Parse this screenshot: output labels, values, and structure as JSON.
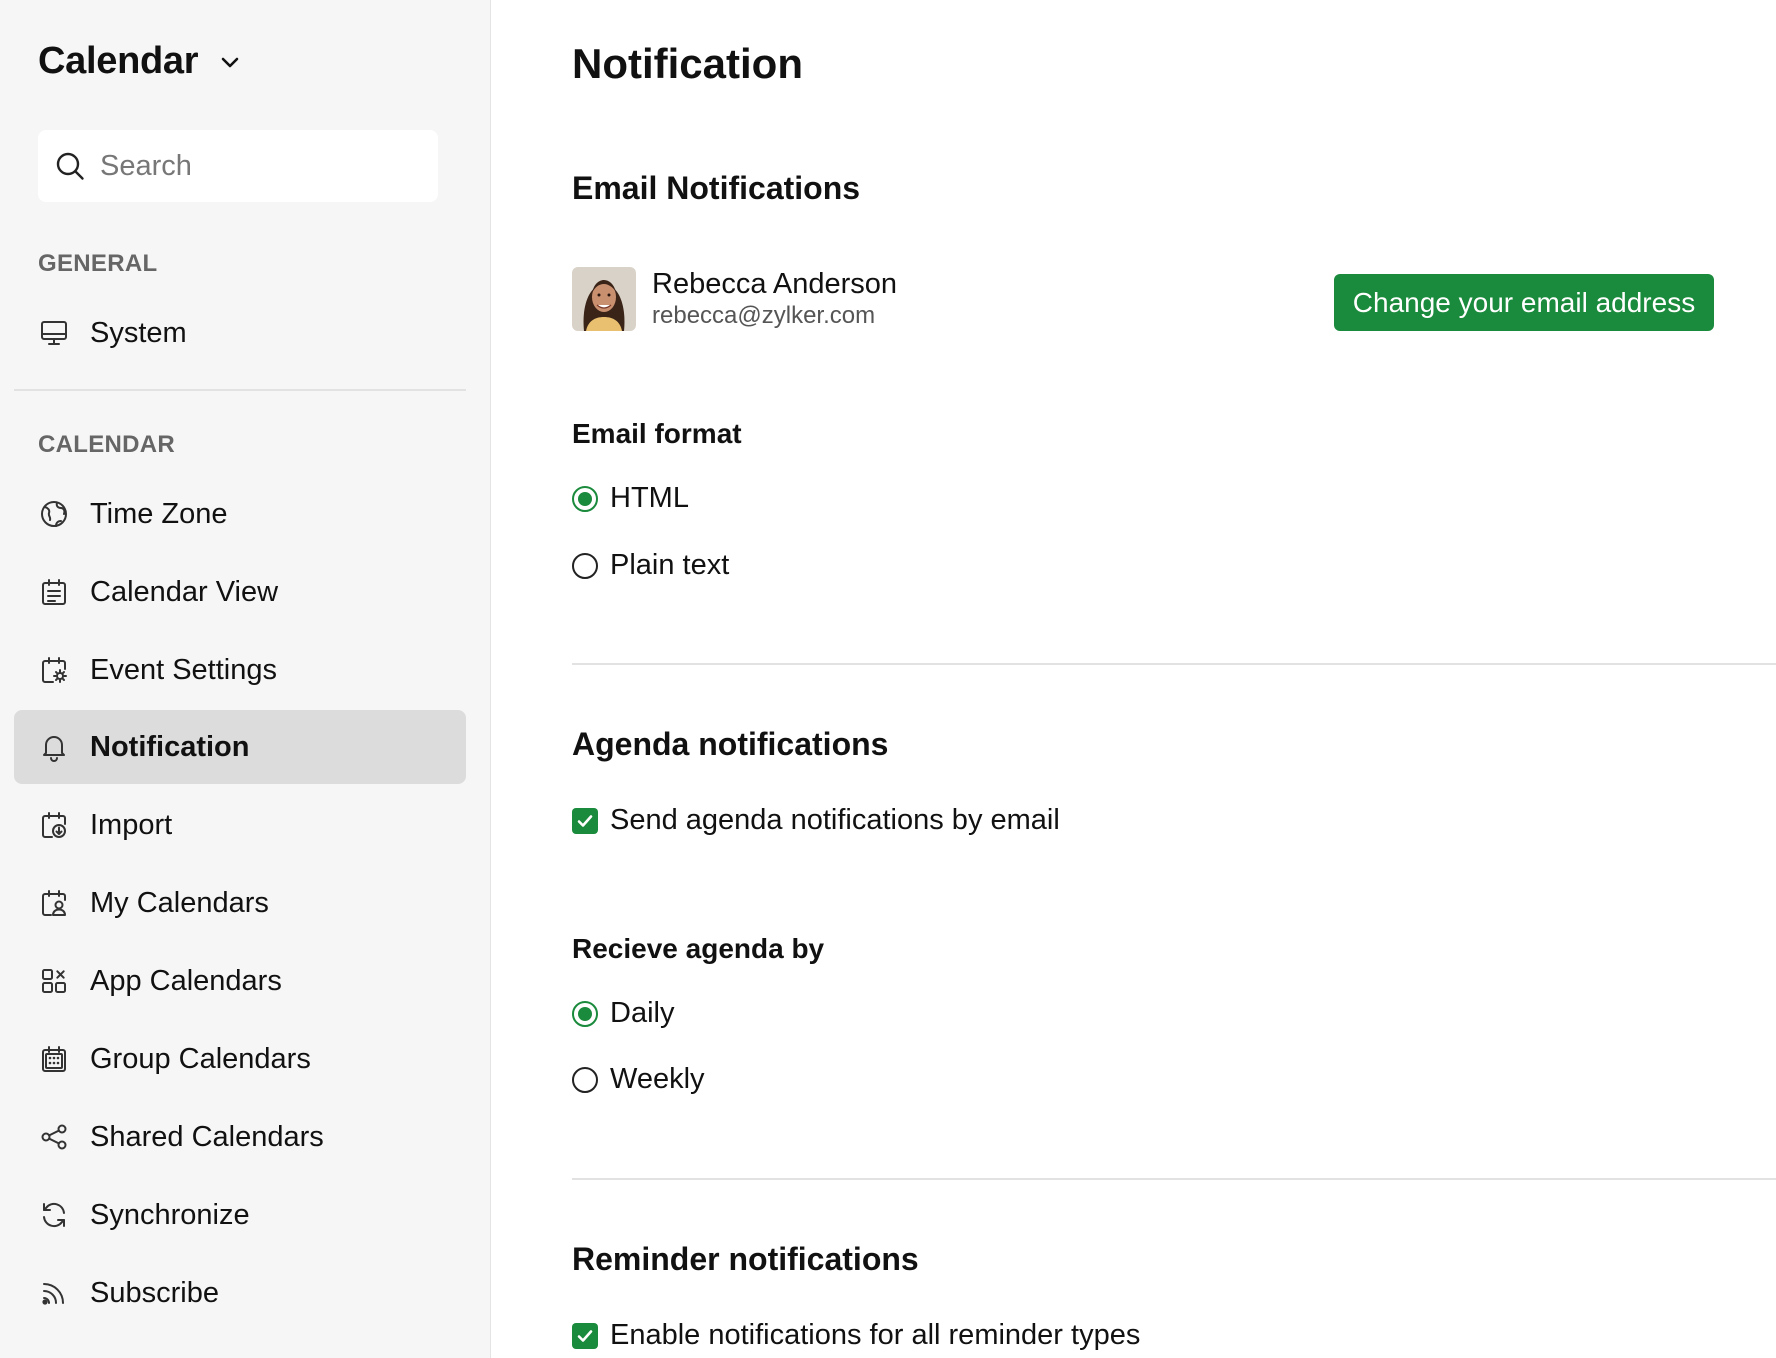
{
  "sidebar": {
    "app_title": "Calendar",
    "search": {
      "placeholder": "Search",
      "value": ""
    },
    "sections": {
      "general": {
        "title": "GENERAL",
        "items": [
          {
            "label": "System",
            "icon": "monitor-icon"
          }
        ]
      },
      "calendar": {
        "title": "CALENDAR",
        "items": [
          {
            "label": "Time Zone",
            "icon": "globe-icon"
          },
          {
            "label": "Calendar View",
            "icon": "calendar-view-icon"
          },
          {
            "label": "Event Settings",
            "icon": "calendar-gear-icon"
          },
          {
            "label": "Notification",
            "icon": "bell-icon",
            "active": true
          },
          {
            "label": "Import",
            "icon": "calendar-import-icon"
          },
          {
            "label": "My Calendars",
            "icon": "calendar-user-icon"
          },
          {
            "label": "App Calendars",
            "icon": "apps-grid-icon"
          },
          {
            "label": "Group Calendars",
            "icon": "calendar-grid-icon"
          },
          {
            "label": "Shared Calendars",
            "icon": "share-icon"
          },
          {
            "label": "Synchronize",
            "icon": "sync-icon"
          },
          {
            "label": "Subscribe",
            "icon": "rss-icon"
          }
        ]
      }
    }
  },
  "main": {
    "title": "Notification",
    "email_notifications": {
      "heading": "Email Notifications",
      "user": {
        "name": "Rebecca Anderson",
        "email": "rebecca@zylker.com"
      },
      "change_button": "Change your email address",
      "format": {
        "label": "Email format",
        "options": [
          {
            "label": "HTML",
            "selected": true
          },
          {
            "label": "Plain text",
            "selected": false
          }
        ]
      }
    },
    "agenda_notifications": {
      "heading": "Agenda notifications",
      "send_by_email": {
        "label": "Send agenda notifications by email",
        "checked": true
      },
      "receive_by": {
        "label": "Recieve agenda by",
        "options": [
          {
            "label": "Daily",
            "selected": true
          },
          {
            "label": "Weekly",
            "selected": false
          }
        ]
      }
    },
    "reminder_notifications": {
      "heading": "Reminder notifications",
      "enable_all": {
        "label": "Enable notifications for all reminder types",
        "checked": true
      }
    }
  },
  "colors": {
    "accent": "#1a8a3c",
    "sidebar_bg": "#f6f6f6",
    "active_item_bg": "#dcdcdc"
  }
}
